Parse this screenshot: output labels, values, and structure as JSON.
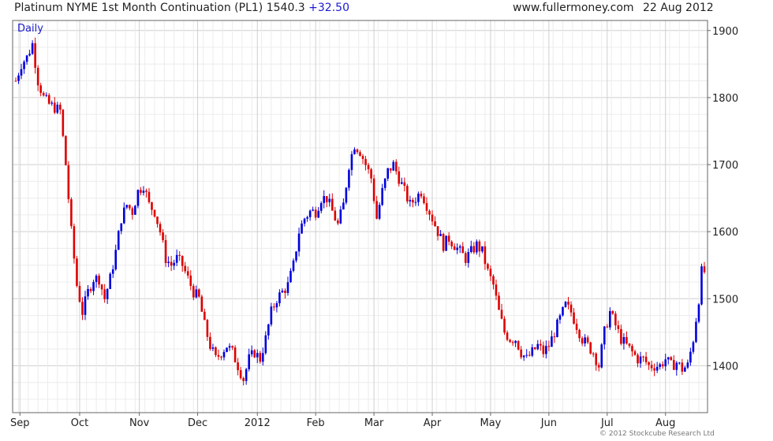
{
  "header": {
    "title": "Platinum NYME 1st Month Continuation (PL1)",
    "last": "1540.3",
    "change": "+32.50",
    "site": "www.fullermoney.com",
    "date": "22 Aug 2012"
  },
  "footer": {
    "copyright": "© 2012 Stockcube Research Ltd"
  },
  "chart_data": {
    "type": "candlestick",
    "period_label": "Daily",
    "ylim": [
      1330,
      1915
    ],
    "y_ticks": [
      1400,
      1500,
      1600,
      1700,
      1800,
      1900
    ],
    "x_tick_labels": [
      "Sep",
      "Oct",
      "Nov",
      "Dec",
      "2012",
      "Feb",
      "Mar",
      "Apr",
      "May",
      "Jun",
      "Jul",
      "Aug"
    ],
    "x_tick_positions": [
      1.5,
      23,
      44.5,
      65.5,
      87,
      108,
      129,
      150,
      171,
      192,
      213,
      234
    ],
    "grid": true,
    "colors": {
      "up": "#0000dd",
      "down": "#dd0000",
      "grid": "#dcdcdc",
      "text": "#222222"
    },
    "waypoints": [
      [
        0,
        1825
      ],
      [
        2,
        1850
      ],
      [
        4,
        1860
      ],
      [
        6,
        1880
      ],
      [
        8,
        1825
      ],
      [
        10,
        1800
      ],
      [
        12,
        1790
      ],
      [
        16,
        1780
      ],
      [
        18,
        1700
      ],
      [
        20,
        1600
      ],
      [
        22,
        1520
      ],
      [
        24,
        1480
      ],
      [
        26,
        1510
      ],
      [
        28,
        1530
      ],
      [
        30,
        1530
      ],
      [
        32,
        1500
      ],
      [
        34,
        1530
      ],
      [
        36,
        1570
      ],
      [
        38,
        1620
      ],
      [
        40,
        1640
      ],
      [
        42,
        1630
      ],
      [
        44,
        1660
      ],
      [
        46,
        1670
      ],
      [
        48,
        1640
      ],
      [
        50,
        1630
      ],
      [
        52,
        1600
      ],
      [
        54,
        1560
      ],
      [
        56,
        1550
      ],
      [
        58,
        1560
      ],
      [
        60,
        1550
      ],
      [
        62,
        1530
      ],
      [
        64,
        1510
      ],
      [
        66,
        1500
      ],
      [
        68,
        1460
      ],
      [
        70,
        1430
      ],
      [
        72,
        1410
      ],
      [
        74,
        1420
      ],
      [
        76,
        1430
      ],
      [
        78,
        1420
      ],
      [
        80,
        1400
      ],
      [
        82,
        1380
      ],
      [
        84,
        1410
      ],
      [
        86,
        1420
      ],
      [
        88,
        1410
      ],
      [
        90,
        1440
      ],
      [
        92,
        1480
      ],
      [
        94,
        1500
      ],
      [
        96,
        1510
      ],
      [
        98,
        1520
      ],
      [
        100,
        1550
      ],
      [
        102,
        1600
      ],
      [
        104,
        1620
      ],
      [
        106,
        1630
      ],
      [
        108,
        1630
      ],
      [
        110,
        1650
      ],
      [
        112,
        1650
      ],
      [
        114,
        1630
      ],
      [
        116,
        1610
      ],
      [
        118,
        1640
      ],
      [
        120,
        1700
      ],
      [
        122,
        1730
      ],
      [
        124,
        1720
      ],
      [
        126,
        1700
      ],
      [
        128,
        1680
      ],
      [
        130,
        1620
      ],
      [
        132,
        1660
      ],
      [
        134,
        1690
      ],
      [
        136,
        1700
      ],
      [
        138,
        1680
      ],
      [
        140,
        1660
      ],
      [
        142,
        1640
      ],
      [
        144,
        1650
      ],
      [
        146,
        1660
      ],
      [
        148,
        1640
      ],
      [
        150,
        1620
      ],
      [
        152,
        1600
      ],
      [
        154,
        1580
      ],
      [
        156,
        1590
      ],
      [
        158,
        1580
      ],
      [
        160,
        1570
      ],
      [
        162,
        1560
      ],
      [
        164,
        1570
      ],
      [
        166,
        1580
      ],
      [
        168,
        1570
      ],
      [
        170,
        1540
      ],
      [
        172,
        1520
      ],
      [
        174,
        1480
      ],
      [
        176,
        1450
      ],
      [
        178,
        1440
      ],
      [
        180,
        1440
      ],
      [
        182,
        1420
      ],
      [
        184,
        1410
      ],
      [
        186,
        1420
      ],
      [
        188,
        1430
      ],
      [
        190,
        1420
      ],
      [
        192,
        1430
      ],
      [
        194,
        1450
      ],
      [
        196,
        1470
      ],
      [
        198,
        1490
      ],
      [
        200,
        1480
      ],
      [
        202,
        1460
      ],
      [
        204,
        1440
      ],
      [
        206,
        1430
      ],
      [
        208,
        1420
      ],
      [
        210,
        1400
      ],
      [
        212,
        1450
      ],
      [
        214,
        1480
      ],
      [
        216,
        1460
      ],
      [
        218,
        1440
      ],
      [
        220,
        1430
      ],
      [
        222,
        1420
      ],
      [
        224,
        1410
      ],
      [
        226,
        1410
      ],
      [
        228,
        1400
      ],
      [
        230,
        1400
      ],
      [
        232,
        1400
      ],
      [
        234,
        1410
      ],
      [
        236,
        1400
      ],
      [
        238,
        1405
      ],
      [
        240,
        1395
      ],
      [
        242,
        1400
      ],
      [
        244,
        1440
      ],
      [
        246,
        1500
      ],
      [
        247,
        1540
      ]
    ]
  }
}
